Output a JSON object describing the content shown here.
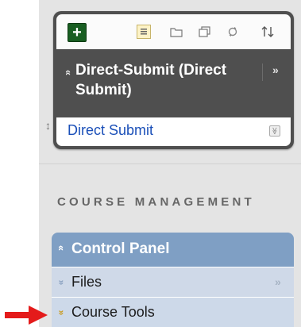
{
  "course_menu": {
    "toolbar": {
      "add_icon": "plus-icon",
      "icons": [
        "list-view-icon",
        "folder-view-icon",
        "windows-icon",
        "refresh-icon",
        "sort-icon"
      ]
    },
    "header": {
      "title": "Direct-Submit (Direct Submit)",
      "collapse_glyph": "«",
      "more_glyph": "»"
    },
    "items": [
      {
        "label": "Direct Submit",
        "badge": "≫"
      }
    ],
    "drag_glyph": "↕"
  },
  "course_management": {
    "section_title": "COURSE MANAGEMENT",
    "control_panel": {
      "title": "Control Panel",
      "collapse_glyph": "«",
      "items": [
        {
          "label": "Files",
          "chevron": "»",
          "more": "»",
          "chevron_color": "#8aa1c0"
        },
        {
          "label": "Course Tools",
          "chevron": "»",
          "chevron_color": "#c99a1e"
        }
      ]
    }
  },
  "colors": {
    "accent_red": "#e41b1b",
    "menu_dark": "#4f4f4f",
    "panel_blue": "#7f9fc4",
    "link_blue": "#1a4fb8"
  }
}
